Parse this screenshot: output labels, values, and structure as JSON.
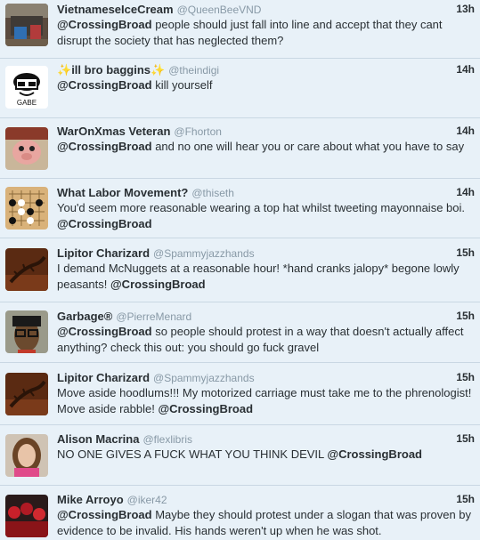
{
  "tweets": [
    {
      "name": "VietnameseIceCream",
      "handle": "@QueenBeeVND",
      "time": "13h",
      "text_pre": "",
      "mention": "@CrossingBroad",
      "text_post": " people should just fall into line and accept that they cant disrupt the society that has neglected them?",
      "avatar": "room-photo-icon"
    },
    {
      "name": "ill bro baggins",
      "name_prefix": "✨",
      "name_suffix": "✨",
      "handle": "@theindigi",
      "time": "14h",
      "text_pre": "",
      "mention": "@CrossingBroad",
      "text_post": " kill yourself",
      "avatar": "cartoon-face-icon",
      "avatar_text": "GABE"
    },
    {
      "name": "WarOnXmas Veteran",
      "handle": "@Fhorton",
      "time": "14h",
      "text_pre": "",
      "mention": "@CrossingBroad",
      "text_post": " and no one will hear you or care about what you have to say",
      "avatar": "pig-character-icon"
    },
    {
      "name": "What Labor Movement?",
      "handle": "@thiseth",
      "time": "14h",
      "text_pre": "You'd seem more reasonable wearing a top hat whilst tweeting mayonnaise boi. ",
      "mention": "@CrossingBroad",
      "text_post": "",
      "avatar": "go-board-icon"
    },
    {
      "name": "Lipitor Charizard",
      "handle": "@Spammyjazzhands",
      "time": "15h",
      "text_pre": "I demand McNuggets at a reasonable hour! *hand cranks jalopy* begone lowly peasants! ",
      "mention": "@CrossingBroad",
      "text_post": "",
      "avatar": "lizard-icon"
    },
    {
      "name": "Garbage®",
      "handle": "@PierreMenard",
      "time": "15h",
      "text_pre": "",
      "mention": "@CrossingBroad",
      "text_post": " so people should protest in a way that doesn't actually affect anything? check this out: you should go fuck gravel",
      "avatar": "man-glasses-icon"
    },
    {
      "name": "Lipitor Charizard",
      "handle": "@Spammyjazzhands",
      "time": "15h",
      "text_pre": "Move aside hoodlums!!! My motorized carriage must take me to the phrenologist! Move aside rabble! ",
      "mention": "@CrossingBroad",
      "text_post": "",
      "avatar": "lizard-icon"
    },
    {
      "name": "Alison Macrina",
      "handle": "@flexlibris",
      "time": "15h",
      "text_pre": "NO ONE GIVES A FUCK WHAT YOU THINK DEVIL ",
      "mention": "@CrossingBroad",
      "text_post": "",
      "avatar": "woman-photo-icon"
    },
    {
      "name": "Mike Arroyo",
      "handle": "@iker42",
      "time": "15h",
      "text_pre": "",
      "mention": "@CrossingBroad",
      "text_post": " Maybe they should protest under a slogan that was proven by evidence to be invalid. His hands weren't up when he was shot.",
      "avatar": "crowd-photo-icon"
    }
  ]
}
